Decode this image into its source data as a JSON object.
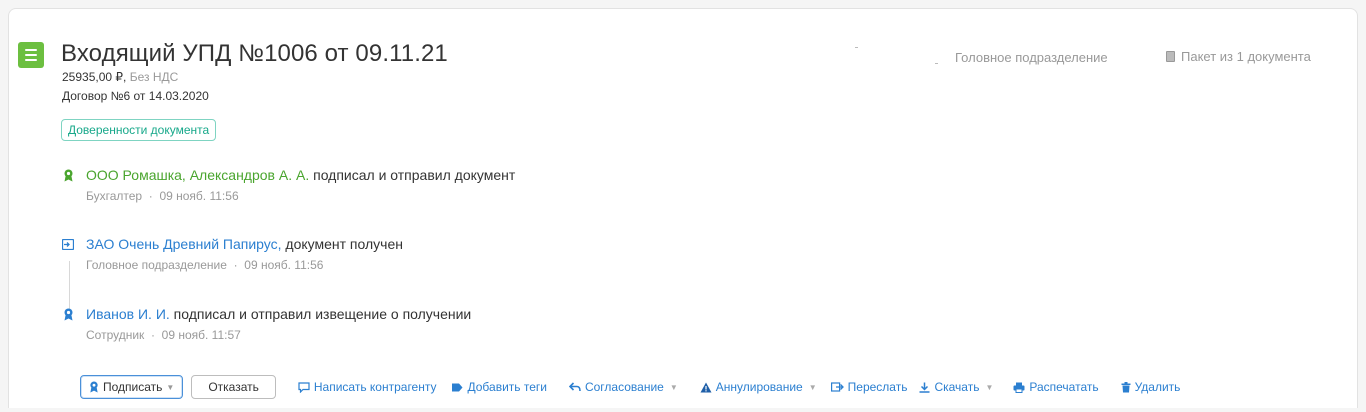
{
  "document": {
    "title": "Входящий УПД №1006 от 09.11.21",
    "amount": "25935,00 ₽,",
    "vat": "Без НДС",
    "contract": "Договор №6 от 14.03.2020",
    "poa_button": "Доверенности документа",
    "department": "Головное подразделение",
    "package": "Пакет из 1 документа"
  },
  "events": [
    {
      "actor": "ООО Ромашка, Александров А. А.",
      "action": "подписал и отправил документ",
      "role": "Бухгалтер",
      "time": "09 нояб. 11:56"
    },
    {
      "actor": "ЗАО Очень Древний Папирус,",
      "action": "документ получен",
      "role": "Головное подразделение",
      "time": "09 нояб. 11:56"
    },
    {
      "actor": "Иванов И. И.",
      "action": "подписал и отправил извещение о получении",
      "role": "Сотрудник",
      "time": "09 нояб. 11:57"
    }
  ],
  "separator": "·",
  "toolbar": {
    "sign": "Подписать",
    "reject": "Отказать",
    "write": "Написать контрагенту",
    "tags": "Добавить теги",
    "approval": "Согласование",
    "annul": "Аннулирование",
    "forward": "Переслать",
    "download": "Скачать",
    "print": "Распечатать",
    "delete": "Удалить"
  },
  "colors": {
    "accent_green": "#6cbf40",
    "link_blue": "#2b7fd0",
    "teal": "#17a88a"
  }
}
